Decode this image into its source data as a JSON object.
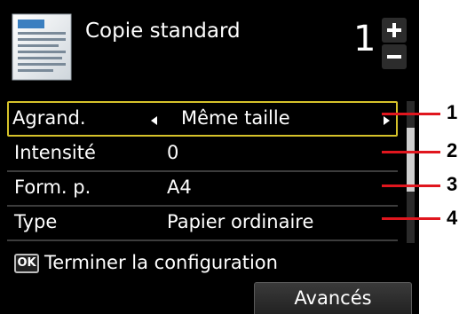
{
  "header": {
    "mode_title": "Copie standard",
    "copies_count": "1",
    "plus_symbol": "+",
    "minus_symbol": "−"
  },
  "settings": [
    {
      "label": "Agrand.",
      "value": "Même taille",
      "selected": true
    },
    {
      "label": "Intensité",
      "value": "0"
    },
    {
      "label": "Form. p.",
      "value": "A4"
    },
    {
      "label": "Type",
      "value": "Papier ordinaire"
    }
  ],
  "footer": {
    "ok_key": "OK",
    "ok_hint": "Terminer la configuration",
    "avances_label": "Avancés"
  },
  "callouts": [
    "1",
    "2",
    "3",
    "4"
  ],
  "colors": {
    "screen_bg": "#000000",
    "selection_border": "#d6c22a",
    "callout_line": "#e0161e"
  },
  "icons": {
    "document": "document-icon",
    "plus_minus": "plus-minus-stepper-icon",
    "arrow_left": "arrow-left-icon",
    "arrow_right": "arrow-right-icon"
  }
}
